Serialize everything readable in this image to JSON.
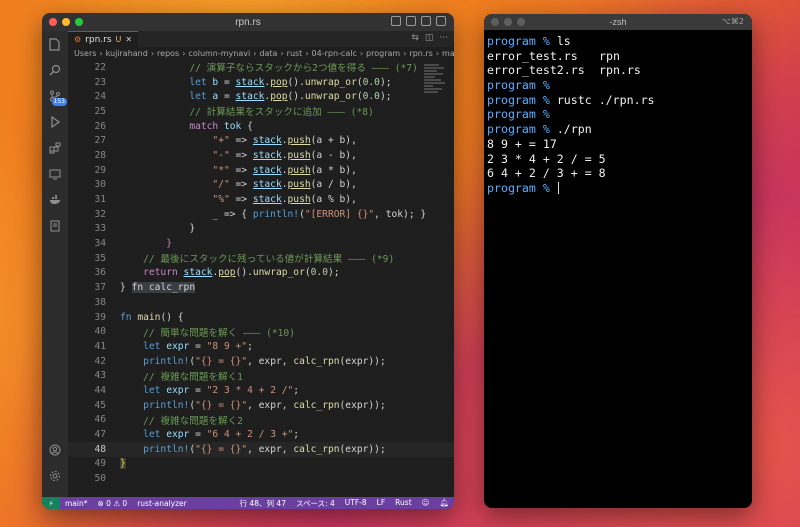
{
  "editor_window": {
    "title": "rpn.rs",
    "activity_badge": "153",
    "tab": {
      "label": "rpn.rs",
      "modified_marker": "U",
      "close": "✕"
    },
    "breadcrumb": [
      "Users",
      "kujirahand",
      "repos",
      "column-mynavi",
      "data",
      "rust",
      "04-rpn-calc",
      "program",
      "rpn.rs",
      "main"
    ],
    "current_line": 48,
    "lines": [
      {
        "n": 22,
        "indent": 3,
        "segments": [
          {
            "t": "// 演算子ならスタックから2つ値を得る ——— (*7)",
            "c": "#6a9955"
          }
        ]
      },
      {
        "n": 23,
        "indent": 3,
        "segments": [
          {
            "t": "let ",
            "c": "#569cd6"
          },
          {
            "t": "b",
            "c": "#9cdcfe"
          },
          {
            "t": " = ",
            "c": "#d4d4d4"
          },
          {
            "t": "stack",
            "c": "#9cdcfe",
            "u": true
          },
          {
            "t": ".",
            "c": "#d4d4d4"
          },
          {
            "t": "pop",
            "c": "#dcdcaa",
            "u": true
          },
          {
            "t": "().",
            "c": "#d4d4d4"
          },
          {
            "t": "unwrap_or",
            "c": "#dcdcaa"
          },
          {
            "t": "(",
            "c": "#d4d4d4"
          },
          {
            "t": "0.0",
            "c": "#b5cea8"
          },
          {
            "t": ");",
            "c": "#d4d4d4"
          }
        ]
      },
      {
        "n": 24,
        "indent": 3,
        "segments": [
          {
            "t": "let ",
            "c": "#569cd6"
          },
          {
            "t": "a",
            "c": "#9cdcfe"
          },
          {
            "t": " = ",
            "c": "#d4d4d4"
          },
          {
            "t": "stack",
            "c": "#9cdcfe",
            "u": true
          },
          {
            "t": ".",
            "c": "#d4d4d4"
          },
          {
            "t": "pop",
            "c": "#dcdcaa",
            "u": true
          },
          {
            "t": "().",
            "c": "#d4d4d4"
          },
          {
            "t": "unwrap_or",
            "c": "#dcdcaa"
          },
          {
            "t": "(",
            "c": "#d4d4d4"
          },
          {
            "t": "0.0",
            "c": "#b5cea8"
          },
          {
            "t": ");",
            "c": "#d4d4d4"
          }
        ]
      },
      {
        "n": 25,
        "indent": 3,
        "segments": [
          {
            "t": "// 計算結果をスタックに追加 ——— (*8)",
            "c": "#6a9955"
          }
        ]
      },
      {
        "n": 26,
        "indent": 3,
        "segments": [
          {
            "t": "match ",
            "c": "#c586c0"
          },
          {
            "t": "tok",
            "c": "#9cdcfe"
          },
          {
            "t": " {",
            "c": "#d4d4d4"
          }
        ]
      },
      {
        "n": 27,
        "indent": 4,
        "segments": [
          {
            "t": "\"+\"",
            "c": "#ce9178"
          },
          {
            "t": " => ",
            "c": "#d4d4d4"
          },
          {
            "t": "stack",
            "c": "#9cdcfe",
            "u": true
          },
          {
            "t": ".",
            "c": "#d4d4d4"
          },
          {
            "t": "push",
            "c": "#dcdcaa",
            "u": true
          },
          {
            "t": "(a + b),",
            "c": "#d4d4d4"
          }
        ]
      },
      {
        "n": 28,
        "indent": 4,
        "segments": [
          {
            "t": "\"-\"",
            "c": "#ce9178"
          },
          {
            "t": " => ",
            "c": "#d4d4d4"
          },
          {
            "t": "stack",
            "c": "#9cdcfe",
            "u": true
          },
          {
            "t": ".",
            "c": "#d4d4d4"
          },
          {
            "t": "push",
            "c": "#dcdcaa",
            "u": true
          },
          {
            "t": "(a - b),",
            "c": "#d4d4d4"
          }
        ]
      },
      {
        "n": 29,
        "indent": 4,
        "segments": [
          {
            "t": "\"*\"",
            "c": "#ce9178"
          },
          {
            "t": " => ",
            "c": "#d4d4d4"
          },
          {
            "t": "stack",
            "c": "#9cdcfe",
            "u": true
          },
          {
            "t": ".",
            "c": "#d4d4d4"
          },
          {
            "t": "push",
            "c": "#dcdcaa",
            "u": true
          },
          {
            "t": "(a * b),",
            "c": "#d4d4d4"
          }
        ]
      },
      {
        "n": 30,
        "indent": 4,
        "segments": [
          {
            "t": "\"/\"",
            "c": "#ce9178"
          },
          {
            "t": " => ",
            "c": "#d4d4d4"
          },
          {
            "t": "stack",
            "c": "#9cdcfe",
            "u": true
          },
          {
            "t": ".",
            "c": "#d4d4d4"
          },
          {
            "t": "push",
            "c": "#dcdcaa",
            "u": true
          },
          {
            "t": "(a / b),",
            "c": "#d4d4d4"
          }
        ]
      },
      {
        "n": 31,
        "indent": 4,
        "segments": [
          {
            "t": "\"%\"",
            "c": "#ce9178"
          },
          {
            "t": " => ",
            "c": "#d4d4d4"
          },
          {
            "t": "stack",
            "c": "#9cdcfe",
            "u": true
          },
          {
            "t": ".",
            "c": "#d4d4d4"
          },
          {
            "t": "push",
            "c": "#dcdcaa",
            "u": true
          },
          {
            "t": "(a % b),",
            "c": "#d4d4d4"
          }
        ]
      },
      {
        "n": 32,
        "indent": 4,
        "segments": [
          {
            "t": "_ => { ",
            "c": "#d4d4d4"
          },
          {
            "t": "println!",
            "c": "#569cd6"
          },
          {
            "t": "(",
            "c": "#d4d4d4"
          },
          {
            "t": "\"[ERROR] {}\"",
            "c": "#ce9178"
          },
          {
            "t": ", tok); }",
            "c": "#d4d4d4"
          }
        ]
      },
      {
        "n": 33,
        "indent": 3,
        "segments": [
          {
            "t": "}",
            "c": "#d4d4d4"
          }
        ]
      },
      {
        "n": 34,
        "indent": 2,
        "segments": [
          {
            "t": "}",
            "c": "#c586c0"
          }
        ]
      },
      {
        "n": 35,
        "indent": 1,
        "segments": [
          {
            "t": "// 最後にスタックに残っている値が計算結果 ——— (*9)",
            "c": "#6a9955"
          }
        ]
      },
      {
        "n": 36,
        "indent": 1,
        "segments": [
          {
            "t": "return ",
            "c": "#c586c0"
          },
          {
            "t": "stack",
            "c": "#9cdcfe",
            "u": true
          },
          {
            "t": ".",
            "c": "#d4d4d4"
          },
          {
            "t": "pop",
            "c": "#dcdcaa",
            "u": true
          },
          {
            "t": "().",
            "c": "#d4d4d4"
          },
          {
            "t": "unwrap_or",
            "c": "#dcdcaa"
          },
          {
            "t": "(",
            "c": "#d4d4d4"
          },
          {
            "t": "0.0",
            "c": "#b5cea8"
          },
          {
            "t": ");",
            "c": "#d4d4d4"
          }
        ]
      },
      {
        "n": 37,
        "indent": 0,
        "segments": [
          {
            "t": "} ",
            "c": "#d4d4d4"
          },
          {
            "t": "fn calc_rpn",
            "c": "#d4d4d4",
            "bg": "#3a3d41"
          }
        ]
      },
      {
        "n": 38,
        "indent": 0,
        "segments": []
      },
      {
        "n": 39,
        "indent": 0,
        "segments": [
          {
            "t": "fn ",
            "c": "#569cd6"
          },
          {
            "t": "main",
            "c": "#dcdcaa"
          },
          {
            "t": "() {",
            "c": "#d4d4d4"
          }
        ]
      },
      {
        "n": 40,
        "indent": 1,
        "segments": [
          {
            "t": "// 簡単な問題を解く ——— (*10)",
            "c": "#6a9955"
          }
        ]
      },
      {
        "n": 41,
        "indent": 1,
        "segments": [
          {
            "t": "let ",
            "c": "#569cd6"
          },
          {
            "t": "expr",
            "c": "#9cdcfe"
          },
          {
            "t": " = ",
            "c": "#d4d4d4"
          },
          {
            "t": "\"8 9 +\"",
            "c": "#ce9178"
          },
          {
            "t": ";",
            "c": "#d4d4d4"
          }
        ]
      },
      {
        "n": 42,
        "indent": 1,
        "segments": [
          {
            "t": "println!",
            "c": "#569cd6"
          },
          {
            "t": "(",
            "c": "#d4d4d4"
          },
          {
            "t": "\"{} = {}\"",
            "c": "#ce9178"
          },
          {
            "t": ", expr, ",
            "c": "#d4d4d4"
          },
          {
            "t": "calc_rpn",
            "c": "#dcdcaa"
          },
          {
            "t": "(expr));",
            "c": "#d4d4d4"
          }
        ]
      },
      {
        "n": 43,
        "indent": 1,
        "segments": [
          {
            "t": "// 複雑な問題を解く1",
            "c": "#6a9955"
          }
        ]
      },
      {
        "n": 44,
        "indent": 1,
        "segments": [
          {
            "t": "let ",
            "c": "#569cd6"
          },
          {
            "t": "expr",
            "c": "#9cdcfe"
          },
          {
            "t": " = ",
            "c": "#d4d4d4"
          },
          {
            "t": "\"2 3 * 4 + 2 /\"",
            "c": "#ce9178"
          },
          {
            "t": ";",
            "c": "#d4d4d4"
          }
        ]
      },
      {
        "n": 45,
        "indent": 1,
        "segments": [
          {
            "t": "println!",
            "c": "#569cd6"
          },
          {
            "t": "(",
            "c": "#d4d4d4"
          },
          {
            "t": "\"{} = {}\"",
            "c": "#ce9178"
          },
          {
            "t": ", expr, ",
            "c": "#d4d4d4"
          },
          {
            "t": "calc_rpn",
            "c": "#dcdcaa"
          },
          {
            "t": "(expr));",
            "c": "#d4d4d4"
          }
        ]
      },
      {
        "n": 46,
        "indent": 1,
        "segments": [
          {
            "t": "// 複雑な問題を解く2",
            "c": "#6a9955"
          }
        ]
      },
      {
        "n": 47,
        "indent": 1,
        "segments": [
          {
            "t": "let ",
            "c": "#569cd6"
          },
          {
            "t": "expr",
            "c": "#9cdcfe"
          },
          {
            "t": " = ",
            "c": "#d4d4d4"
          },
          {
            "t": "\"6 4 + 2 / 3 +\"",
            "c": "#ce9178"
          },
          {
            "t": ";",
            "c": "#d4d4d4"
          }
        ]
      },
      {
        "n": 48,
        "indent": 1,
        "segments": [
          {
            "t": "println!",
            "c": "#569cd6"
          },
          {
            "t": "(",
            "c": "#d4d4d4"
          },
          {
            "t": "\"{} = {}\"",
            "c": "#ce9178"
          },
          {
            "t": ", expr, ",
            "c": "#d4d4d4"
          },
          {
            "t": "calc_rpn",
            "c": "#dcdcaa"
          },
          {
            "t": "(expr));",
            "c": "#d4d4d4"
          }
        ]
      },
      {
        "n": 49,
        "indent": 0,
        "segments": [
          {
            "t": "}",
            "c": "#ffd700",
            "bg": "#3a3d41"
          }
        ]
      },
      {
        "n": 50,
        "indent": 0,
        "segments": []
      }
    ],
    "status": {
      "branch": "main*",
      "problems": "⊗ 0 ⚠ 0",
      "language_server": "rust-analyzer",
      "position": "行 48、列 47",
      "spaces": "スペース: 4",
      "encoding": "UTF-8",
      "eol": "LF",
      "language": "Rust"
    }
  },
  "terminal_window": {
    "title": "-zsh",
    "shortcut": "⌥⌘2",
    "lines": [
      {
        "prompt": "program % ",
        "text": "ls"
      },
      {
        "cols": [
          "error_test.rs",
          "rpn"
        ]
      },
      {
        "cols": [
          "error_test2.rs",
          "rpn.rs"
        ]
      },
      {
        "prompt": "program % ",
        "text": ""
      },
      {
        "prompt": "program % ",
        "text": "rustc ./rpn.rs"
      },
      {
        "prompt": "program % ",
        "text": ""
      },
      {
        "prompt": "program % ",
        "text": "./rpn"
      },
      {
        "text": "8 9 + = 17"
      },
      {
        "text": "2 3 * 4 + 2 / = 5"
      },
      {
        "text": "6 4 + 2 / 3 + = 8"
      },
      {
        "prompt": "program % ",
        "text": "",
        "cursor": true
      }
    ]
  },
  "colors": {
    "prompt": "#5aaeff",
    "status_bar": "#6b3fa0",
    "remote": "#16825d"
  }
}
